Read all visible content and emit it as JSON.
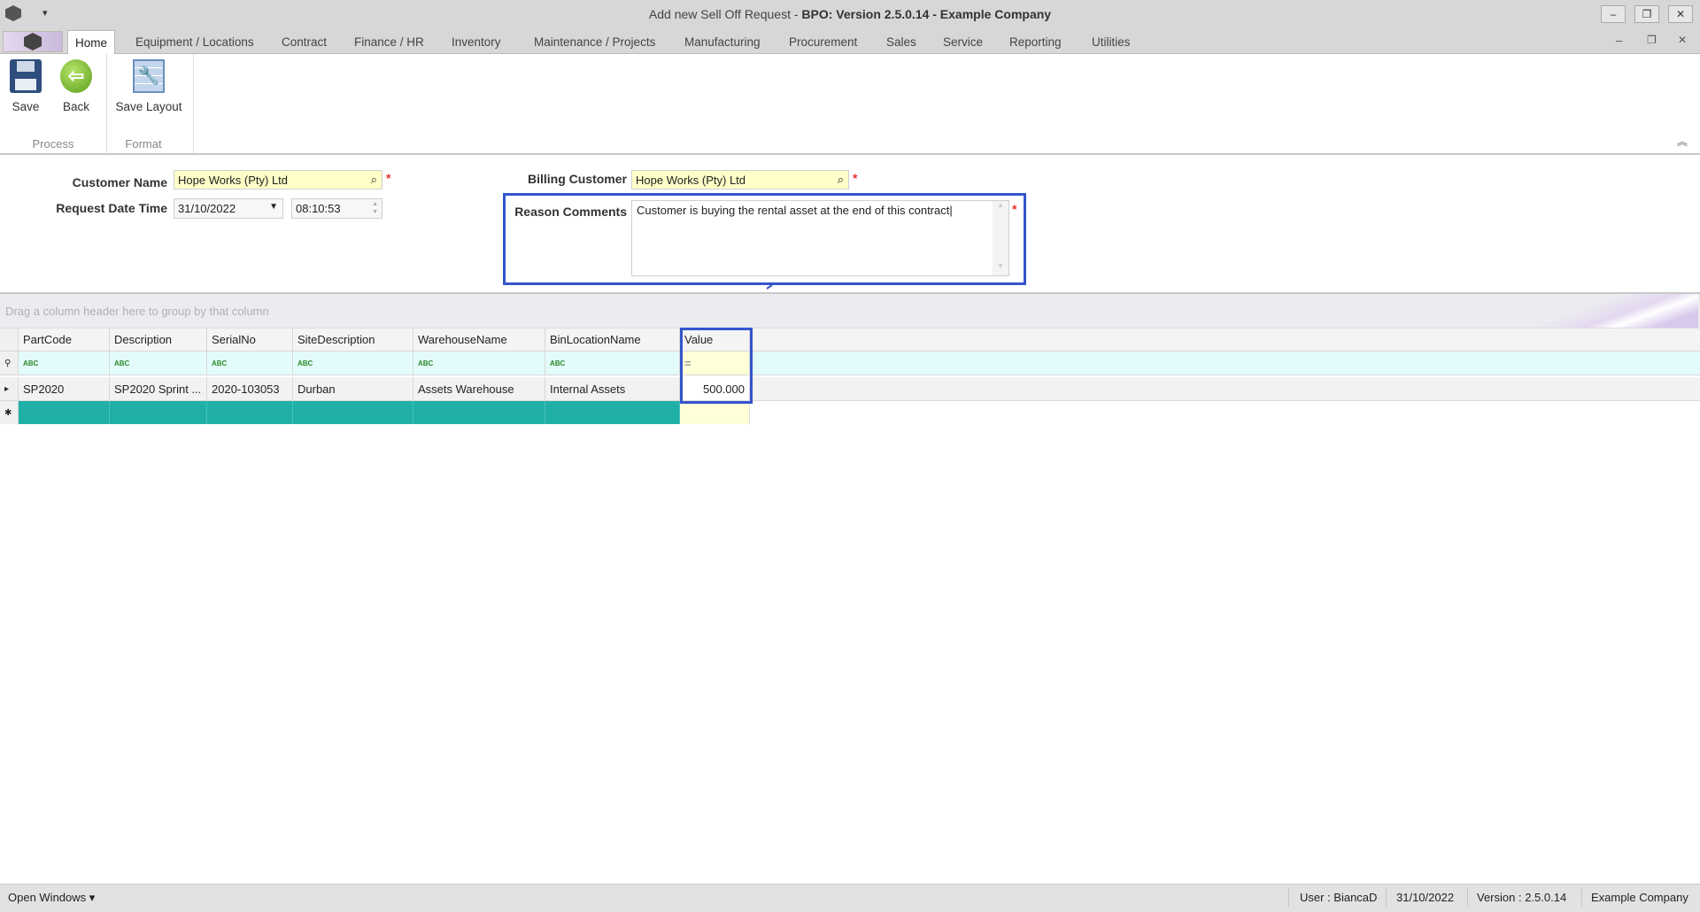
{
  "window": {
    "title_prefix": "Add new Sell Off Request - ",
    "title_bold": "BPO: Version 2.5.0.14 - Example Company",
    "minimize": "–",
    "restore": "❐",
    "close": "✕"
  },
  "tabs": [
    {
      "label": "Home",
      "active": true
    },
    {
      "label": "Equipment / Locations"
    },
    {
      "label": "Contract"
    },
    {
      "label": "Finance / HR"
    },
    {
      "label": "Inventory"
    },
    {
      "label": "Maintenance / Projects"
    },
    {
      "label": "Manufacturing"
    },
    {
      "label": "Procurement"
    },
    {
      "label": "Sales"
    },
    {
      "label": "Service"
    },
    {
      "label": "Reporting"
    },
    {
      "label": "Utilities"
    }
  ],
  "ribbon": {
    "save": "Save",
    "back": "Back",
    "save_layout": "Save Layout",
    "group_process": "Process",
    "group_format": "Format"
  },
  "form": {
    "customer_name_label": "Customer Name",
    "customer_name": "Hope Works (Pty) Ltd",
    "request_date_label": "Request Date  Time",
    "request_date": "31/10/2022",
    "request_time": "08:10:53",
    "billing_customer_label": "Billing Customer",
    "billing_customer": "Hope Works (Pty) Ltd",
    "reason_label": "Reason Comments",
    "reason": "Customer is buying the rental asset at the end of this contract",
    "required_mark": "*"
  },
  "grid": {
    "group_hint": "Drag a column header here to group by that column",
    "columns": [
      "PartCode",
      "Description",
      "SerialNo",
      "SiteDescription",
      "WarehouseName",
      "BinLocationName",
      "Value"
    ],
    "filter_abc": "ABC",
    "filter_eq": "=",
    "rows": [
      [
        "SP2020",
        "SP2020 Sprint ...",
        "2020-103053",
        "Durban",
        "Assets Warehouse",
        "Internal Assets",
        "500.000"
      ]
    ]
  },
  "status": {
    "open_windows": "Open Windows ▾",
    "user": "User : BiancaD",
    "date": "31/10/2022",
    "version": "Version : 2.5.0.14",
    "company": "Example Company"
  },
  "colors": {
    "highlight": "#3355cc",
    "new_row": "#20b0a8",
    "required": "#ffffc8"
  }
}
